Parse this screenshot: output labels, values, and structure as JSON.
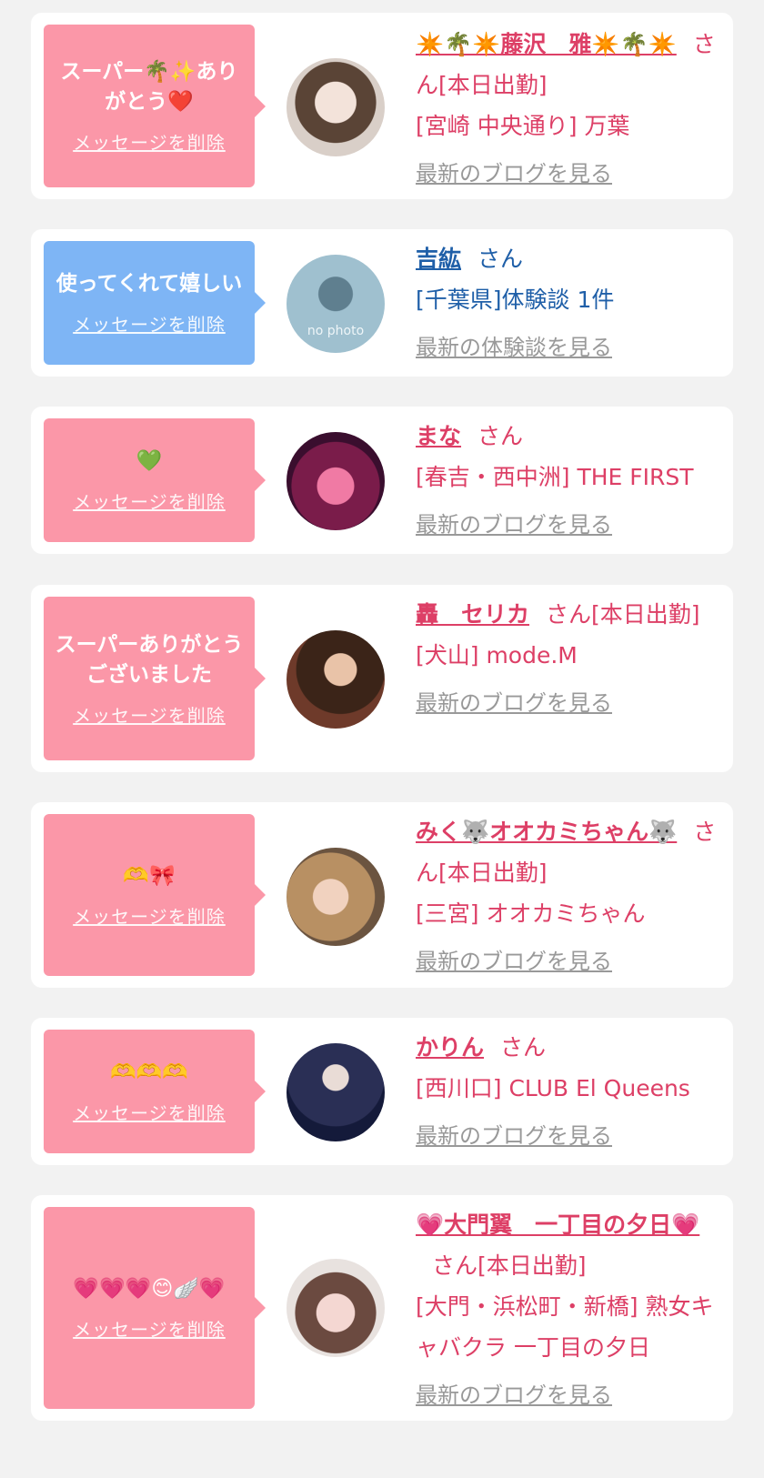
{
  "cards": [
    {
      "bubble_color": "#fb97a8",
      "message": "スーパー🌴✨ありがとう❤️",
      "delete_label": "メッセージを削除",
      "name": "✴️🌴✴️藤沢　雅✴️🌴✴️",
      "suffix": "さん[本日出勤]",
      "shop": "[宮崎 中央通り] 万葉",
      "link": "最新のブログを見る"
    },
    {
      "bubble_color": "#7eb5f5",
      "message": "使ってくれて嬉しい",
      "delete_label": "メッセージを削除",
      "name": "吉紘",
      "suffix": "さん",
      "shop": "[千葉県]体験談 1件",
      "link": "最新の体験談を見る",
      "avatar_text": "no photo"
    },
    {
      "bubble_color": "#fb97a8",
      "message": "💚",
      "delete_label": "メッセージを削除",
      "name": "まな",
      "suffix": "さん",
      "shop": "[春吉・西中洲] THE FIRST",
      "link": "最新のブログを見る"
    },
    {
      "bubble_color": "#fb97a8",
      "message": "スーパーありがとうございました",
      "delete_label": "メッセージを削除",
      "name": "轟　セリカ",
      "suffix": "さん[本日出勤]",
      "shop": "[犬山] mode.M",
      "link": "最新のブログを見る"
    },
    {
      "bubble_color": "#fb97a8",
      "message": "🫶🎀",
      "delete_label": "メッセージを削除",
      "name": "みく🐺オオカミちゃん🐺",
      "suffix": "さん[本日出勤]",
      "shop": "[三宮] オオカミちゃん",
      "link": "最新のブログを見る"
    },
    {
      "bubble_color": "#fb97a8",
      "message": "🫶🫶🫶",
      "delete_label": "メッセージを削除",
      "name": "かりん",
      "suffix": "さん",
      "shop": "[西川口] CLUB El Queens",
      "link": "最新のブログを見る"
    },
    {
      "bubble_color": "#fb97a8",
      "message": "💗💗💗😊🪽💗",
      "delete_label": "メッセージを削除",
      "name": "💗大門翼　一丁目の夕日💗",
      "suffix": "さん[本日出勤]",
      "shop": "[大門・浜松町・新橋] 熟女キャバクラ 一丁目の夕日",
      "link": "最新のブログを見る"
    }
  ]
}
